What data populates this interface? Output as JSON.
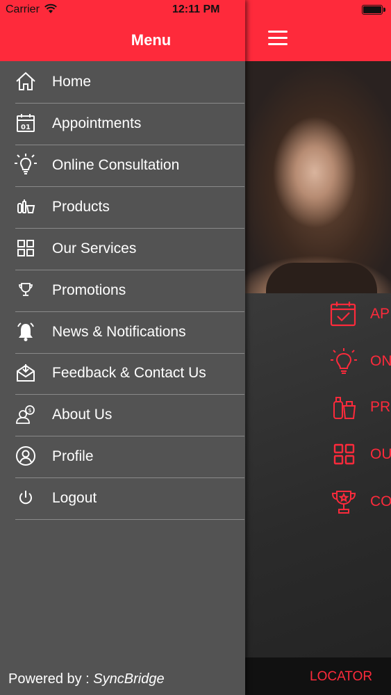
{
  "status_bar": {
    "carrier": "Carrier",
    "time": "12:11 PM"
  },
  "drawer": {
    "title": "Menu",
    "items": [
      {
        "label": "Home",
        "icon": "home-icon"
      },
      {
        "label": "Appointments",
        "icon": "calendar-icon"
      },
      {
        "label": "Online Consultation",
        "icon": "lightbulb-icon"
      },
      {
        "label": "Products",
        "icon": "products-icon"
      },
      {
        "label": "Our Services",
        "icon": "grid-icon"
      },
      {
        "label": "Promotions",
        "icon": "trophy-icon"
      },
      {
        "label": "News & Notifications",
        "icon": "bell-icon"
      },
      {
        "label": "Feedback & Contact Us",
        "icon": "mail-icon"
      },
      {
        "label": "About Us",
        "icon": "about-icon"
      },
      {
        "label": "Profile",
        "icon": "user-circle-icon"
      },
      {
        "label": "Logout",
        "icon": "power-icon"
      }
    ],
    "footer_prefix": "Powered by : ",
    "footer_brand": "SyncBridge"
  },
  "main": {
    "items": [
      {
        "label": "AP",
        "icon": "calendar-check-icon"
      },
      {
        "label": "ON",
        "icon": "lightbulb-icon"
      },
      {
        "label": "PR",
        "icon": "products-icon"
      },
      {
        "label": "OU",
        "icon": "grid-icon"
      },
      {
        "label": "CO",
        "icon": "trophy-icon"
      }
    ],
    "bottom_label": "LOCATOR"
  },
  "colors": {
    "accent": "#fe2a3b",
    "drawer_bg": "#535353",
    "main_bg": "#2e2e2e"
  }
}
